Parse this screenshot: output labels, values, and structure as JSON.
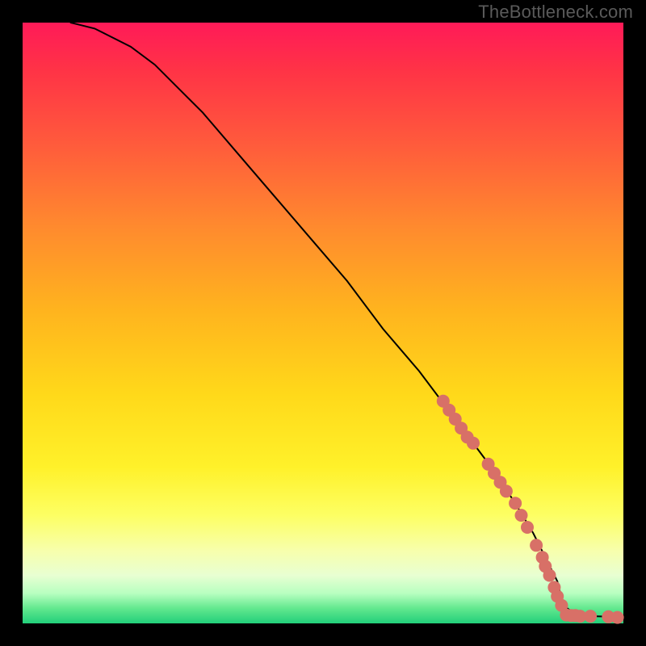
{
  "watermark": "TheBottleneck.com",
  "colors": {
    "page_bg": "#000000",
    "marker": "#d87067",
    "line": "#000000"
  },
  "chart_data": {
    "type": "line",
    "title": "",
    "xlabel": "",
    "ylabel": "",
    "xlim": [
      0,
      100
    ],
    "ylim": [
      0,
      100
    ],
    "grid": false,
    "legend": false,
    "series": [
      {
        "name": "curve",
        "x": [
          8,
          10,
          12,
          14,
          18,
          22,
          26,
          30,
          36,
          42,
          48,
          54,
          60,
          66,
          72,
          78,
          82,
          85,
          87,
          89,
          90,
          92,
          95,
          98,
          100
        ],
        "values": [
          100,
          99.5,
          99,
          98,
          96,
          93,
          89,
          85,
          78,
          71,
          64,
          57,
          49,
          42,
          34,
          26,
          20,
          15,
          11,
          7,
          3,
          1.5,
          1.2,
          1.1,
          1
        ]
      }
    ],
    "markers": [
      {
        "x": 70,
        "y": 37
      },
      {
        "x": 71,
        "y": 35.5
      },
      {
        "x": 72,
        "y": 34
      },
      {
        "x": 73,
        "y": 32.5
      },
      {
        "x": 74,
        "y": 31
      },
      {
        "x": 75,
        "y": 30
      },
      {
        "x": 77.5,
        "y": 26.5
      },
      {
        "x": 78.5,
        "y": 25
      },
      {
        "x": 79.5,
        "y": 23.5
      },
      {
        "x": 80.5,
        "y": 22
      },
      {
        "x": 82,
        "y": 20
      },
      {
        "x": 83,
        "y": 18
      },
      {
        "x": 84,
        "y": 16
      },
      {
        "x": 85.5,
        "y": 13
      },
      {
        "x": 86.5,
        "y": 11
      },
      {
        "x": 87,
        "y": 9.5
      },
      {
        "x": 87.7,
        "y": 8
      },
      {
        "x": 88.5,
        "y": 6
      },
      {
        "x": 89,
        "y": 4.5
      },
      {
        "x": 89.7,
        "y": 3
      },
      {
        "x": 90.5,
        "y": 1.4
      },
      {
        "x": 91.3,
        "y": 1.3
      },
      {
        "x": 92,
        "y": 1.3
      },
      {
        "x": 92.8,
        "y": 1.2
      },
      {
        "x": 94.5,
        "y": 1.2
      },
      {
        "x": 97.5,
        "y": 1.1
      },
      {
        "x": 99,
        "y": 1
      }
    ]
  }
}
